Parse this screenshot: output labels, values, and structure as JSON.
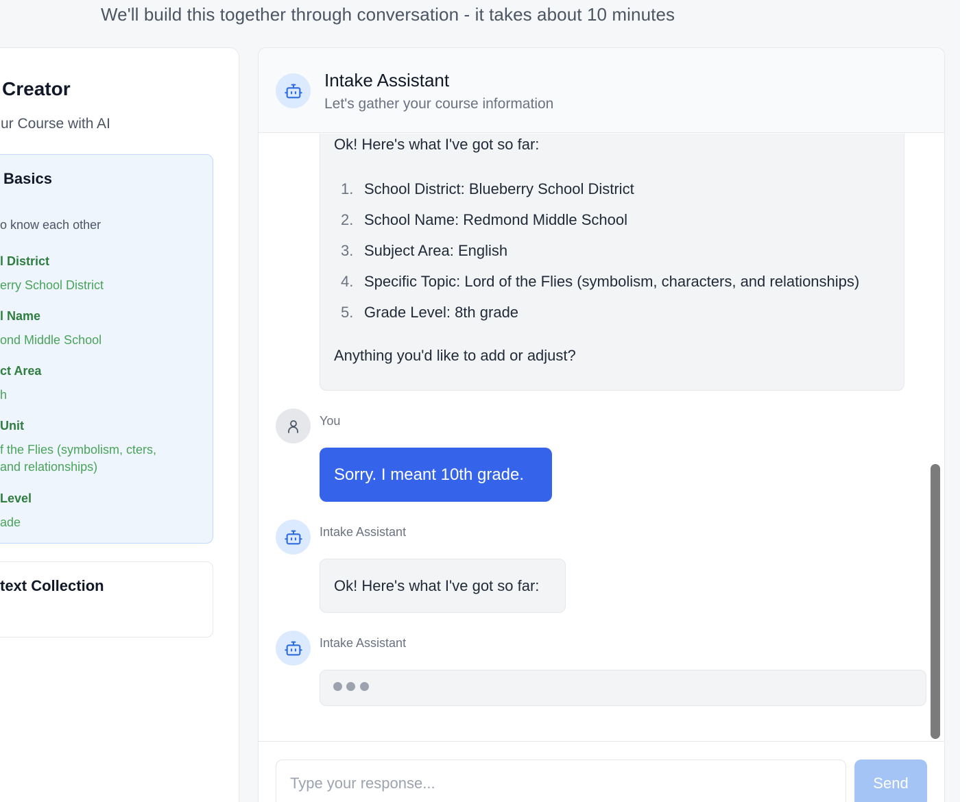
{
  "page": {
    "subtitle": "We'll build this together through conversation - it takes about 10 minutes"
  },
  "left_panel": {
    "title": "Creator",
    "subtitle": "ur Course with AI",
    "basics": {
      "title": "Basics",
      "description": "o know each other",
      "fields": [
        {
          "label": "l District",
          "value": "erry School District"
        },
        {
          "label": "l Name",
          "value": "ond Middle School"
        },
        {
          "label": "ct Area",
          "value": "h"
        },
        {
          "label": "Unit",
          "value": "f the Flies (symbolism, cters, and relationships)"
        },
        {
          "label": "Level",
          "value": "ade"
        }
      ]
    },
    "context": {
      "title": "text Collection"
    }
  },
  "chat": {
    "header": {
      "name": "Intake Assistant",
      "subtitle": "Let's gather your course information",
      "avatar_icon": "robot-icon"
    },
    "summary": {
      "intro": "Ok! Here's what I've got so far:",
      "items": [
        {
          "num": "1.",
          "text": "School District: Blueberry School District"
        },
        {
          "num": "2.",
          "text": "School Name: Redmond Middle School"
        },
        {
          "num": "3.",
          "text": "Subject Area: English"
        },
        {
          "num": "4.",
          "text": "Specific Topic: Lord of the Flies (symbolism, characters, and relationships)"
        },
        {
          "num": "5.",
          "text": "Grade Level: 8th grade"
        }
      ],
      "outro": "Anything you'd like to add or adjust?"
    },
    "messages": [
      {
        "sender": "You",
        "text": "Sorry. I meant 10th grade.",
        "avatar_icon": "user-icon"
      },
      {
        "sender": "Intake Assistant",
        "text": "Ok! Here's what I've got so far:",
        "avatar_icon": "robot-icon"
      },
      {
        "sender": "Intake Assistant",
        "typing": true,
        "avatar_icon": "robot-icon"
      }
    ],
    "composer": {
      "placeholder": "Type your response...",
      "send_label": "Send"
    }
  },
  "colors": {
    "accent": "#3563e9",
    "send_disabled": "#a3c4f5",
    "success_text": "#2f7d3f",
    "basics_bg": "#eef5fd"
  }
}
